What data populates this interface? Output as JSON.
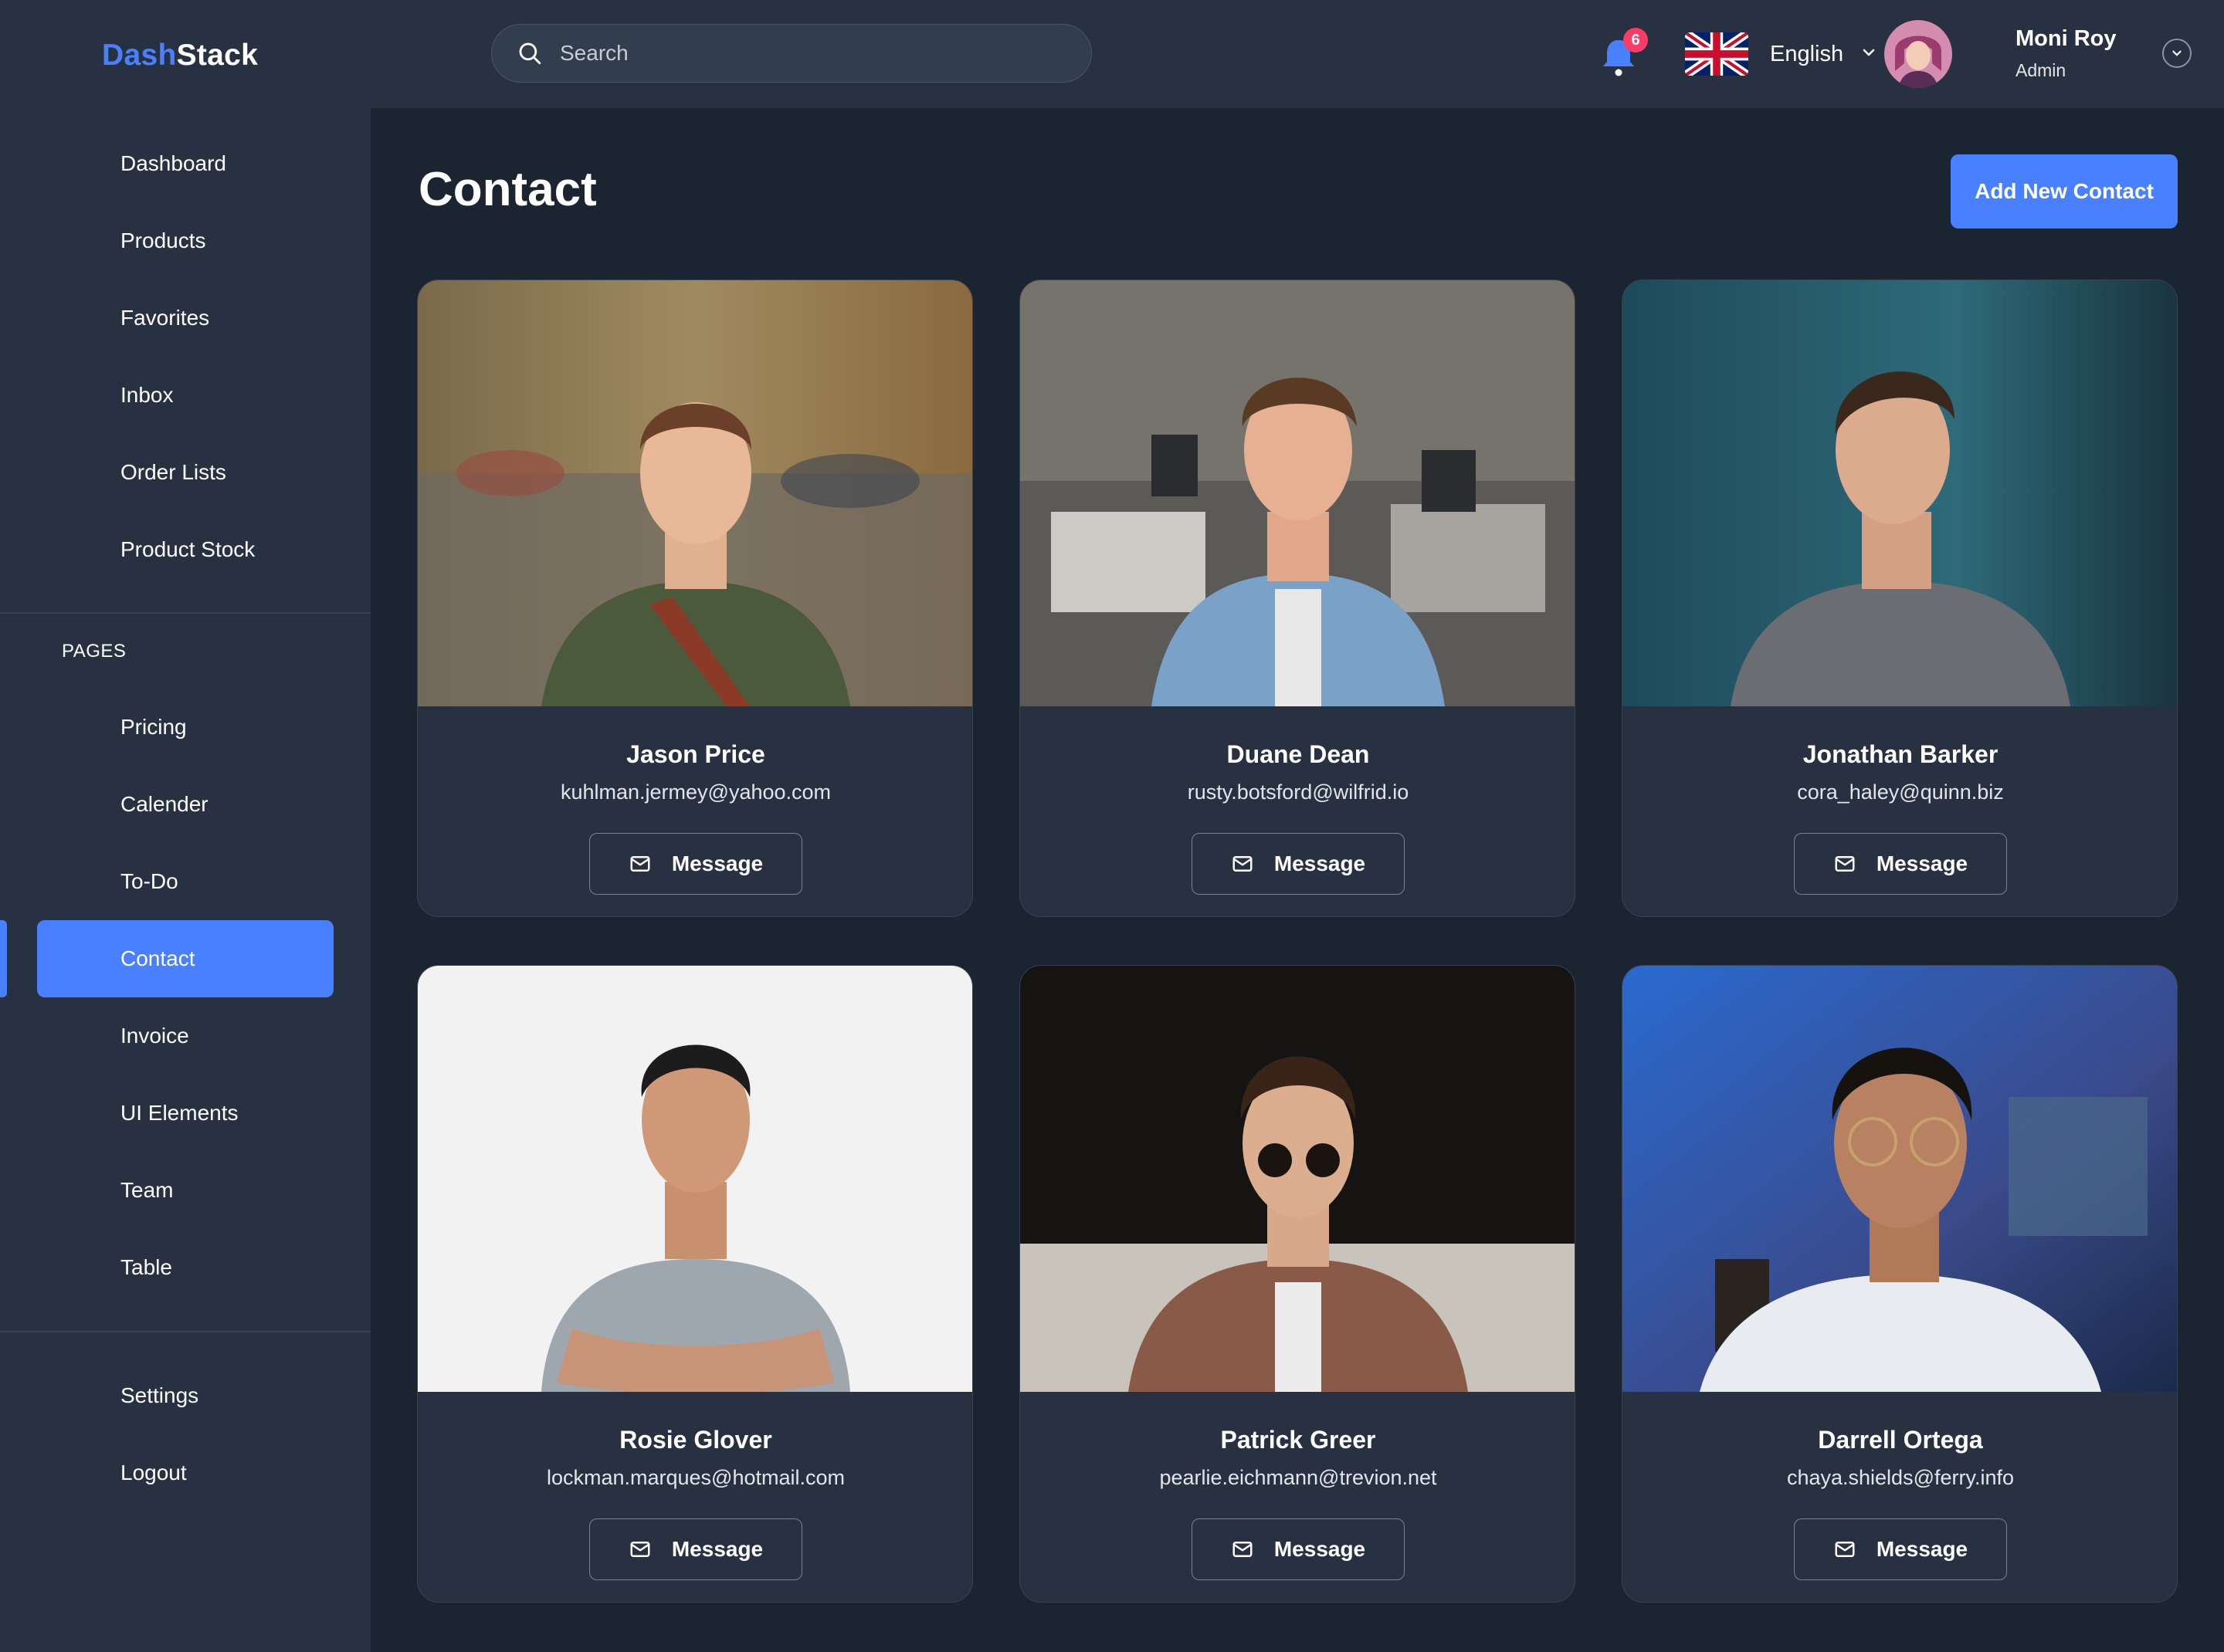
{
  "app": {
    "logo_accent": "Dash",
    "logo_rest": "Stack"
  },
  "sidebar": {
    "main_items": [
      {
        "label": "Dashboard"
      },
      {
        "label": "Products"
      },
      {
        "label": "Favorites"
      },
      {
        "label": "Inbox"
      },
      {
        "label": "Order Lists"
      },
      {
        "label": "Product Stock"
      }
    ],
    "section_label": "PAGES",
    "page_items": [
      {
        "label": "Pricing"
      },
      {
        "label": "Calender"
      },
      {
        "label": "To-Do"
      },
      {
        "label": "Contact",
        "active": true
      },
      {
        "label": "Invoice"
      },
      {
        "label": "UI Elements"
      },
      {
        "label": "Team"
      },
      {
        "label": "Table"
      }
    ],
    "bottom_items": [
      {
        "label": "Settings"
      },
      {
        "label": "Logout"
      }
    ]
  },
  "header": {
    "search_placeholder": "Search",
    "notification_count": "6",
    "language": "English",
    "user": {
      "name": "Moni Roy",
      "role": "Admin"
    }
  },
  "main": {
    "title": "Contact",
    "add_button_label": "Add New Contact",
    "message_button_label": "Message",
    "contacts": [
      {
        "name": "Jason Price",
        "email": "kuhlman.jermey@yahoo.com"
      },
      {
        "name": "Duane Dean",
        "email": "rusty.botsford@wilfrid.io"
      },
      {
        "name": "Jonathan Barker",
        "email": "cora_haley@quinn.biz"
      },
      {
        "name": "Rosie Glover",
        "email": "lockman.marques@hotmail.com"
      },
      {
        "name": "Patrick Greer",
        "email": "pearlie.eichmann@trevion.net"
      },
      {
        "name": "Darrell Ortega",
        "email": "chaya.shields@ferry.info"
      }
    ]
  },
  "colors": {
    "accent": "#4880ff",
    "sidebar_bg": "#273142",
    "page_bg": "#1b2431",
    "badge": "#f93c65"
  },
  "icons": {
    "search": "search-icon",
    "notification": "bell-icon",
    "flag": "uk-flag-icon",
    "chevron": "chevron-down-icon",
    "message": "mail-icon"
  }
}
